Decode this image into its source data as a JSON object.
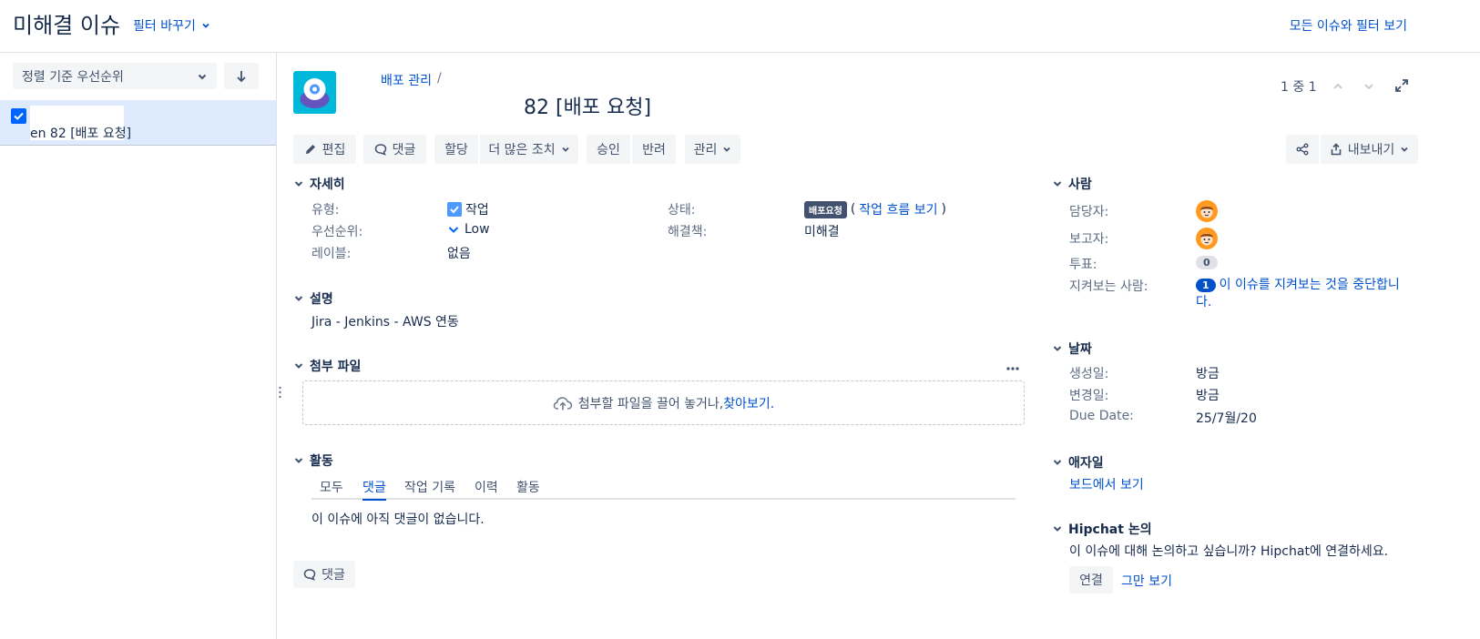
{
  "header": {
    "title": "미해결 이슈",
    "filter_switch": "필터 바꾸기",
    "view_all": "모든 이슈와 필터 보기"
  },
  "sidebar": {
    "sort_label": "정렬 기준 우선순위",
    "items": [
      {
        "text": "en 82 [배포 요청]",
        "checked": true
      }
    ]
  },
  "issue": {
    "breadcrumb": "배포 관리",
    "breadcrumb_sep": "/",
    "title": "82 [배포 요청]",
    "pager": "1 중 1",
    "actions": {
      "edit": "편집",
      "comment": "댓글",
      "assign": "할당",
      "more": "더 많은 조치",
      "approve": "승인",
      "reject": "반려",
      "manage": "관리",
      "export": "내보내기"
    },
    "details": {
      "heading": "자세히",
      "type_label": "유형:",
      "type_value": "작업",
      "priority_label": "우선순위:",
      "priority_value": "Low",
      "labels_label": "레이블:",
      "labels_value": "없음",
      "status_label": "상태:",
      "status_badge": "배포요청",
      "workflow_open": "(",
      "workflow_link": "작업 흐름 보기",
      "workflow_close": ")",
      "resolution_label": "해결책:",
      "resolution_value": "미해결"
    },
    "description": {
      "heading": "설명",
      "text": "Jira - Jenkins - AWS 연동"
    },
    "attachments": {
      "heading": "첨부 파일",
      "drop_text": "첨부할 파일을 끌어 놓거나, ",
      "browse_link": "찾아보기."
    },
    "activity": {
      "heading": "활동",
      "tabs": [
        "모두",
        "댓글",
        "작업 기록",
        "이력",
        "활동"
      ],
      "active_tab": "댓글",
      "empty": "이 이슈에 아직 댓글이 없습니다.",
      "comment_button": "댓글"
    }
  },
  "people": {
    "heading": "사람",
    "assignee_label": "담당자:",
    "reporter_label": "보고자:",
    "votes_label": "투표:",
    "votes_count": "0",
    "watchers_label": "지켜보는 사람:",
    "watchers_count": "1",
    "watch_stop_link": "이 이슈를 지켜보는 것을 중단합니다."
  },
  "dates": {
    "heading": "날짜",
    "created_label": "생성일:",
    "created_value": "방금",
    "updated_label": "변경일:",
    "updated_value": "방금",
    "due_label": "Due Date:",
    "due_value": "25/7월/20"
  },
  "agile": {
    "heading": "애자일",
    "board_link": "보드에서 보기"
  },
  "hipchat": {
    "heading": "Hipchat 논의",
    "prompt": "이 이슈에 대해 논의하고 싶습니까? Hipchat에 연결하세요.",
    "connect_button": "연결",
    "dismiss_link": "그만 보기"
  },
  "colors": {
    "link": "#0052cc",
    "selected_bg": "#deebff",
    "checkbox": "#0065ff",
    "badge_bg": "#42526e",
    "avatar": "#ff991f",
    "project_icon_bg": "#00b8d9"
  }
}
